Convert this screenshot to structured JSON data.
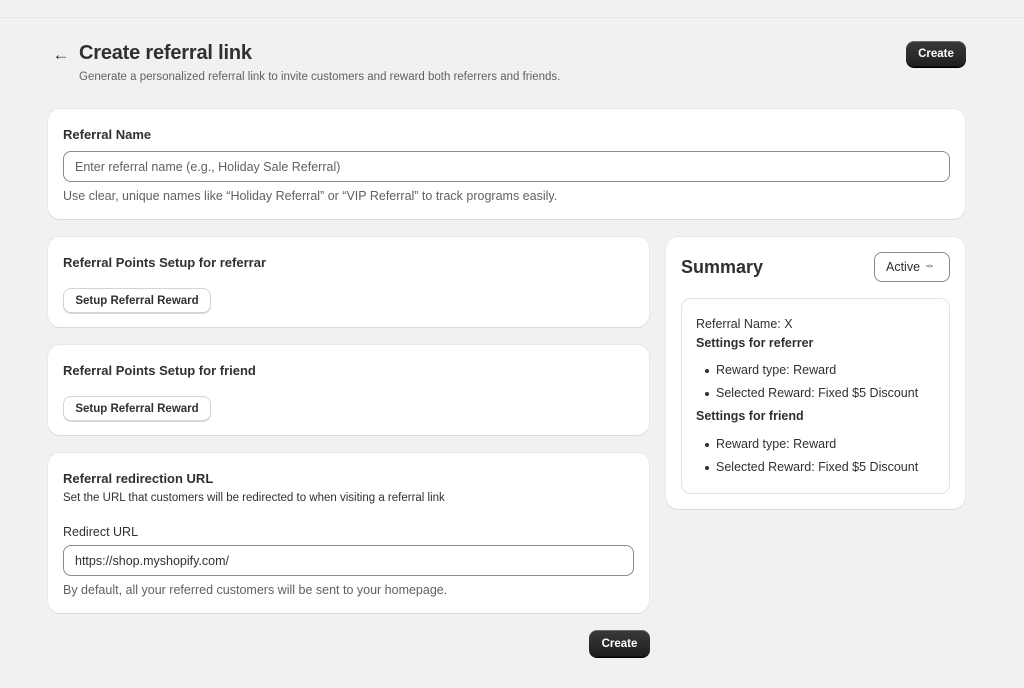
{
  "header": {
    "title": "Create referral link",
    "subtitle": "Generate a personalized referral link to invite customers and reward both referrers and friends.",
    "back_icon": "arrow-left-icon",
    "create_label": "Create"
  },
  "referral_name": {
    "title": "Referral Name",
    "placeholder": "Enter referral name (e.g., Holiday Sale Referral)",
    "value": "",
    "help": "Use clear, unique names like “Holiday Referral” or “VIP Referral” to track programs easily."
  },
  "referrer_setup": {
    "title": "Referral Points Setup for referrar",
    "button_label": "Setup Referral Reward"
  },
  "friend_setup": {
    "title": "Referral Points Setup for friend",
    "button_label": "Setup Referral Reward"
  },
  "redirection": {
    "title": "Referral redirection URL",
    "description": "Set the URL that customers will be redirected to when visiting a referral link",
    "field_label": "Redirect URL",
    "value": "https://shop.myshopify.com/",
    "help": "By default, all your referred customers will be sent to your homepage."
  },
  "footer": {
    "create_label": "Create"
  },
  "summary": {
    "title": "Summary",
    "status": "Active",
    "name_line": "Referral Name: X",
    "referrer_heading": "Settings for referrer",
    "referrer_items": [
      "Reward type: Reward",
      "Selected Reward: Fixed $5 Discount"
    ],
    "friend_heading": "Settings for friend",
    "friend_items": [
      "Reward type: Reward",
      "Selected Reward: Fixed $5 Discount"
    ]
  },
  "colors": {
    "background": "#f1f1f1",
    "card": "#ffffff",
    "primary_button": "#303030",
    "text": "#303030",
    "muted_text": "#616161"
  }
}
